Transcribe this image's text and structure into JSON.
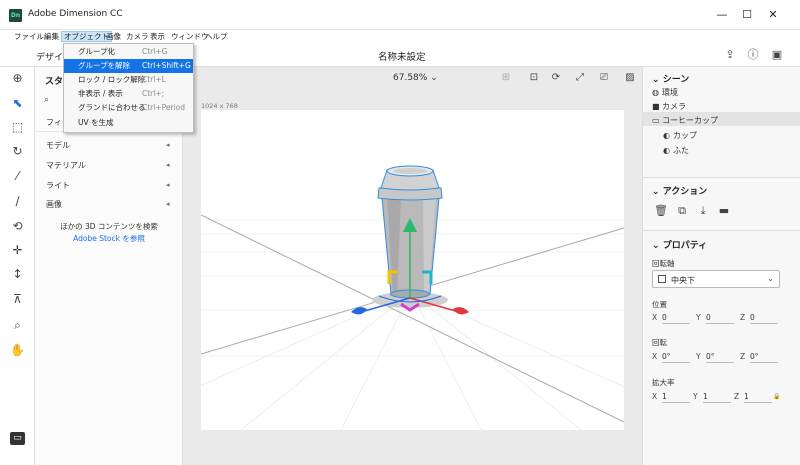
{
  "window": {
    "logo_text": "Dn",
    "title": "Adobe Dimension CC",
    "minimize_glyph": "—",
    "maximize_glyph": "☐",
    "close_glyph": "✕"
  },
  "menubar": {
    "items": [
      "ファイル",
      "編集",
      "オブジェクト",
      "画像",
      "カメラ",
      "表示",
      "ウィンドウ",
      "ヘルプ"
    ]
  },
  "object_menu": {
    "items": [
      {
        "label": "グループ化",
        "shortcut": "Ctrl+G"
      },
      {
        "label": "グループを解除",
        "shortcut": "Ctrl+Shift+G"
      },
      {
        "label": "ロック / ロック解除",
        "shortcut": "Ctrl+L"
      },
      {
        "label": "非表示 / 表示",
        "shortcut": "Ctrl+;"
      },
      {
        "label": "グランドに合わせる",
        "shortcut": "Ctrl+Period"
      },
      {
        "label": "UV を生成",
        "shortcut": ""
      }
    ],
    "highlighted_index": 1
  },
  "toprow": {
    "tab_design": "デザイ",
    "document_title": "名称未設定"
  },
  "left_panel": {
    "header": "スタ",
    "filter_label": "フィ",
    "categories": [
      "モデル",
      "マテリアル",
      "ライト",
      "画像"
    ],
    "search_3d_text": "ほかの 3D コンテンツを検索",
    "adobe_stock_link": "Adobe Stock を参照"
  },
  "canvas": {
    "zoom": "67.58%",
    "dimensions": "1024 x 768"
  },
  "right_panel": {
    "scene_header": "シーン",
    "scene_items": [
      {
        "label": "環境",
        "icon": "environment-icon"
      },
      {
        "label": "カメラ",
        "icon": "camera-icon"
      },
      {
        "label": "コーヒーカップ",
        "icon": "folder-icon"
      },
      {
        "label": "カップ",
        "icon": "object-icon"
      },
      {
        "label": "ふた",
        "icon": "object-icon"
      }
    ],
    "actions_header": "アクション",
    "properties_header": "プロパティ",
    "pivot_label": "回転軸",
    "pivot_value": "中央下",
    "position_label": "位置",
    "position": {
      "x": "0",
      "y": "0",
      "z": "0"
    },
    "rotation_label": "回転",
    "rotation": {
      "x": "0°",
      "y": "0°",
      "z": "0°"
    },
    "scale_label": "拡大率",
    "scale": {
      "x": "1",
      "y": "1",
      "z": "1"
    },
    "axis_labels": {
      "x": "X",
      "y": "Y",
      "z": "Z"
    }
  },
  "colors": {
    "accent": "#1473e6",
    "selection_outline": "#2f8fe0",
    "gizmo_x": "#e0383e",
    "gizmo_y": "#2eb86b",
    "gizmo_z": "#2266e0",
    "gizmo_plane_yellow": "#f3c200",
    "gizmo_plane_cyan": "#1fb5c9",
    "gizmo_plane_magenta": "#d23fd0"
  }
}
